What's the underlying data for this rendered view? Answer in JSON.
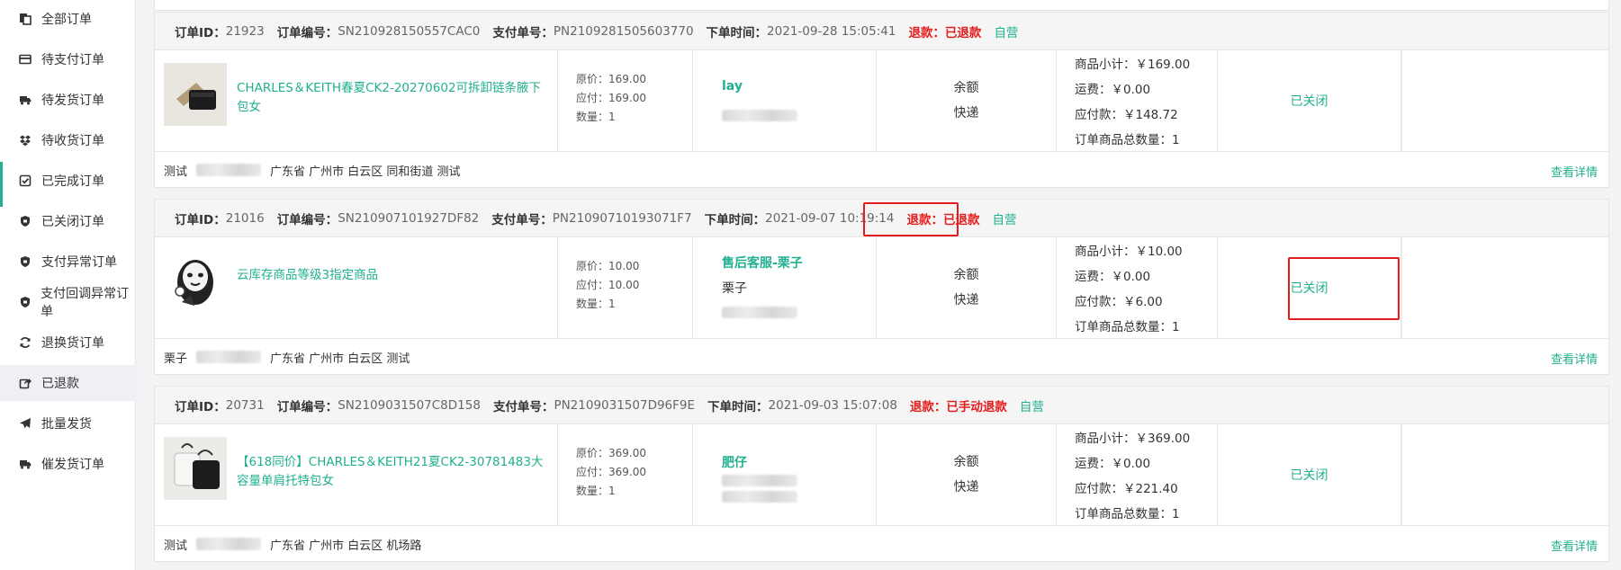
{
  "sidebar": {
    "items": [
      {
        "label": "全部订单",
        "icon": "document-copy-icon"
      },
      {
        "label": "待支付订单",
        "icon": "credit-card-icon"
      },
      {
        "label": "待发货订单",
        "icon": "truck-icon"
      },
      {
        "label": "待收货订单",
        "icon": "dropbox-icon"
      },
      {
        "label": "已完成订单",
        "icon": "check-square-icon"
      },
      {
        "label": "已关闭订单",
        "icon": "shield-icon"
      },
      {
        "label": "支付异常订单",
        "icon": "shield-icon"
      },
      {
        "label": "支付回调异常订单",
        "icon": "shield-icon"
      },
      {
        "label": "退换货订单",
        "icon": "refresh-icon"
      },
      {
        "label": "已退款",
        "icon": "share-square-icon"
      },
      {
        "label": "批量发货",
        "icon": "paper-plane-icon"
      },
      {
        "label": "催发货订单",
        "icon": "truck-icon"
      }
    ],
    "active_index": 9
  },
  "labels": {
    "order_id": "订单ID：",
    "order_no": "订单编号：",
    "pay_no": "支付单号：",
    "order_time": "下单时间：",
    "original_price": "原价：",
    "due_price": "应付：",
    "quantity": "数量：",
    "subtotal": "商品小计：",
    "freight": "运费：",
    "payable": "应付款：",
    "total_qty": "订单商品总数量：",
    "detail": "查看详情"
  },
  "orders": [
    {
      "id": "21923",
      "order_no": "SN210928150557CAC0",
      "pay_no": "PN2109281505603770",
      "time": "2021-09-28 15:05:41",
      "refund": "退款：已退款",
      "tag": "自营",
      "product": "CHARLES＆KEITH春夏CK2-20270602可拆卸链条腋下包女",
      "original": "169.00",
      "due": "169.00",
      "qty": "1",
      "buyer": "lay",
      "buyer_sub": "",
      "pay_method": "余额",
      "ship_method": "快递",
      "subtotal": "￥169.00",
      "freight": "￥0.00",
      "payable": "￥148.72",
      "total_qty": "1",
      "status": "已关闭",
      "foot_name": "测试",
      "address": "广东省 广州市 白云区 同和街道 测试"
    },
    {
      "id": "21016",
      "order_no": "SN210907101927DF82",
      "pay_no": "PN21090710193071F7",
      "time": "2021-09-07 10:19:14",
      "refund": "退款：已退款",
      "tag": "自营",
      "product": "云库存商品等级3指定商品",
      "original": "10.00",
      "due": "10.00",
      "qty": "1",
      "buyer": "售后客服-栗子",
      "buyer_sub": "栗子",
      "pay_method": "余额",
      "ship_method": "快递",
      "subtotal": "￥10.00",
      "freight": "￥0.00",
      "payable": "￥6.00",
      "total_qty": "1",
      "status": "已关闭",
      "foot_name": "栗子",
      "address": "广东省 广州市 白云区 测试"
    },
    {
      "id": "20731",
      "order_no": "SN2109031507C8D158",
      "pay_no": "PN2109031507D96F9E",
      "time": "2021-09-03 15:07:08",
      "refund": "退款：已手动退款",
      "tag": "自营",
      "product": "【618同价】CHARLES＆KEITH21夏CK2-30781483大容量单肩托特包女",
      "original": "369.00",
      "due": "369.00",
      "qty": "1",
      "buyer": "肥仔",
      "buyer_sub": "",
      "pay_method": "余额",
      "ship_method": "快递",
      "subtotal": "￥369.00",
      "freight": "￥0.00",
      "payable": "￥221.40",
      "total_qty": "1",
      "status": "已关闭",
      "foot_name": "测试",
      "address": "广东省 广州市 白云区 机场路"
    }
  ],
  "colors": {
    "accent": "#21b08f",
    "refund": "#e31d1d",
    "highlight_box": "#e31d1d"
  }
}
